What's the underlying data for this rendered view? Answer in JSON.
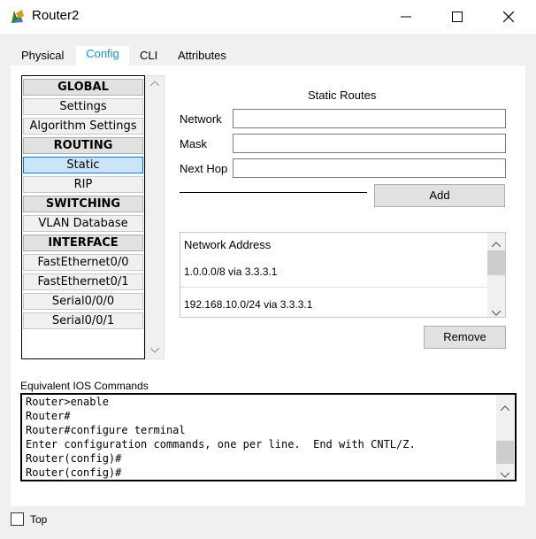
{
  "window": {
    "title": "Router2"
  },
  "tabs": [
    {
      "label": "Physical"
    },
    {
      "label": "Config"
    },
    {
      "label": "CLI"
    },
    {
      "label": "Attributes"
    }
  ],
  "active_tab": "Config",
  "sidebar": {
    "items": [
      {
        "label": "GLOBAL",
        "kind": "header"
      },
      {
        "label": "Settings",
        "kind": "item"
      },
      {
        "label": "Algorithm Settings",
        "kind": "item"
      },
      {
        "label": "ROUTING",
        "kind": "header"
      },
      {
        "label": "Static",
        "kind": "selected"
      },
      {
        "label": "RIP",
        "kind": "item"
      },
      {
        "label": "SWITCHING",
        "kind": "header"
      },
      {
        "label": "VLAN Database",
        "kind": "item"
      },
      {
        "label": "INTERFACE",
        "kind": "header"
      },
      {
        "label": "FastEthernet0/0",
        "kind": "item"
      },
      {
        "label": "FastEthernet0/1",
        "kind": "item"
      },
      {
        "label": "Serial0/0/0",
        "kind": "item"
      },
      {
        "label": "Serial0/0/1",
        "kind": "item"
      }
    ]
  },
  "static_routes": {
    "heading": "Static Routes",
    "network_label": "Network",
    "network_value": "",
    "mask_label": "Mask",
    "mask_value": "",
    "nexthop_label": "Next Hop",
    "nexthop_value": "",
    "add_label": "Add",
    "remove_label": "Remove",
    "list_header": "Network Address",
    "routes": [
      "1.0.0.0/8 via 3.3.3.1",
      "192.168.10.0/24 via 3.3.3.1"
    ]
  },
  "ios": {
    "label": "Equivalent IOS Commands",
    "lines": [
      "Router>enable",
      "Router#",
      "Router#configure terminal",
      "Enter configuration commands, one per line.  End with CNTL/Z.",
      "Router(config)#",
      "Router(config)#"
    ]
  },
  "footer": {
    "top_label": "Top",
    "top_checked": false
  },
  "colors": {
    "accent": "#0078d7",
    "selected_bg": "#cce4f7"
  }
}
